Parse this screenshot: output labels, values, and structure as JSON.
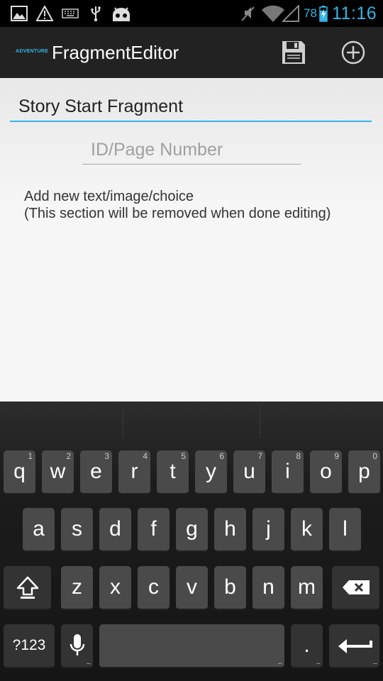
{
  "status_bar": {
    "left_icons": [
      "picture-icon",
      "warning-icon",
      "keyboard-icon",
      "usb-icon",
      "android-icon"
    ],
    "right_icons": [
      "mute-icon",
      "wifi-icon",
      "signal-icon",
      "battery-icon"
    ],
    "battery_percent": "78",
    "time": "11:16",
    "accent_color": "#33b5e5"
  },
  "action_bar": {
    "logo_text": "ADVENTURE",
    "title": "FragmentEditor",
    "actions": [
      "save-icon",
      "add-circle-icon"
    ]
  },
  "editor": {
    "title_value": "Story Start Fragment",
    "id_placeholder": "ID/Page Number",
    "id_value": "",
    "add_new_text": "Add new text/image/choice",
    "removal_note": "(This section will be removed when done editing)"
  },
  "keyboard": {
    "row1": [
      {
        "label": "q",
        "num": "1"
      },
      {
        "label": "w",
        "num": "2"
      },
      {
        "label": "e",
        "num": "3"
      },
      {
        "label": "r",
        "num": "4"
      },
      {
        "label": "t",
        "num": "5"
      },
      {
        "label": "y",
        "num": "6"
      },
      {
        "label": "u",
        "num": "7"
      },
      {
        "label": "i",
        "num": "8"
      },
      {
        "label": "o",
        "num": "9"
      },
      {
        "label": "p",
        "num": "0"
      }
    ],
    "row2": [
      "a",
      "s",
      "d",
      "f",
      "g",
      "h",
      "j",
      "k",
      "l"
    ],
    "row3": [
      "z",
      "x",
      "c",
      "v",
      "b",
      "n",
      "m"
    ],
    "symbols_label": "?123",
    "period_label": "."
  }
}
